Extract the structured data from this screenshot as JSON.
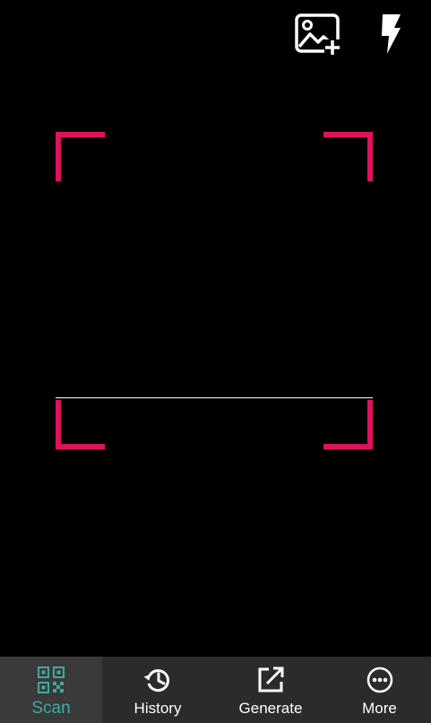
{
  "colors": {
    "background": "#000000",
    "frame_accent": "#e0115f",
    "scan_line": "#ffffff",
    "nav_background": "#2b2b2b",
    "nav_active_background": "#3a3a3a",
    "nav_active_color": "#3fa9a0",
    "nav_text": "#ffffff"
  },
  "top_bar": {
    "gallery_icon": "image-plus-icon",
    "flash_icon": "flash-icon"
  },
  "bottom_nav": {
    "items": [
      {
        "label": "Scan",
        "icon": "qr-code-icon",
        "active": true
      },
      {
        "label": "History",
        "icon": "history-icon",
        "active": false
      },
      {
        "label": "Generate",
        "icon": "external-edit-icon",
        "active": false
      },
      {
        "label": "More",
        "icon": "more-dots-icon",
        "active": false
      }
    ]
  }
}
